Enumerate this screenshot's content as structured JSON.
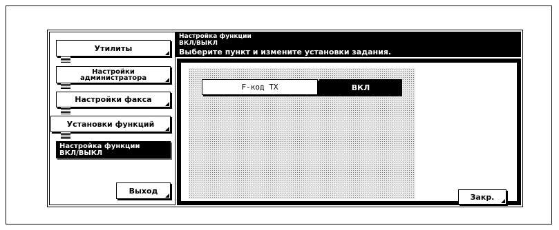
{
  "sidebar": {
    "items": [
      {
        "label": "Утилиты"
      },
      {
        "label": "Настройки\nадминистратора"
      },
      {
        "label": "Настройки факса"
      },
      {
        "label": "Установки функций"
      },
      {
        "label": "Настройка функции\nВКЛ/ВЫКЛ",
        "active": true
      }
    ],
    "exit_label": "Выход"
  },
  "header": {
    "title": "Настройка функции\nВКЛ/ВЫКЛ",
    "instruction": "Выберите пункт и измените установки задания."
  },
  "settings": [
    {
      "name": "F-код TX",
      "value": "ВКЛ"
    }
  ],
  "footer": {
    "close_label": "Закр."
  },
  "colors": {
    "background": "#ffffff",
    "ink": "#000000",
    "highlight": "#000000"
  }
}
